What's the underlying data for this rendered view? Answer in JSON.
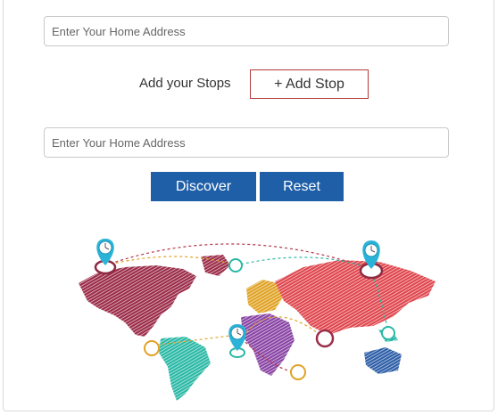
{
  "form": {
    "home_address_placeholder": "Enter Your Home Address",
    "stops_label": "Add your Stops",
    "add_stop_label": "+ Add Stop",
    "destination_placeholder": "Enter Your Home Address"
  },
  "actions": {
    "discover_label": "Discover",
    "reset_label": "Reset"
  },
  "illustration": {
    "name": "world-map-with-route-pins",
    "colors": {
      "north_america": "#9c2d4a",
      "south_america": "#2bb9a6",
      "europe": "#e0a326",
      "africa": "#8a45a5",
      "asia": "#e0484f",
      "australia": "#2f5fa8",
      "pin": "#2ab3d9",
      "route_red": "#b33a4a",
      "route_teal": "#2bb9a6",
      "route_orange": "#e0a326"
    },
    "pins": [
      "pin-north-america",
      "pin-asia",
      "pin-africa"
    ]
  }
}
